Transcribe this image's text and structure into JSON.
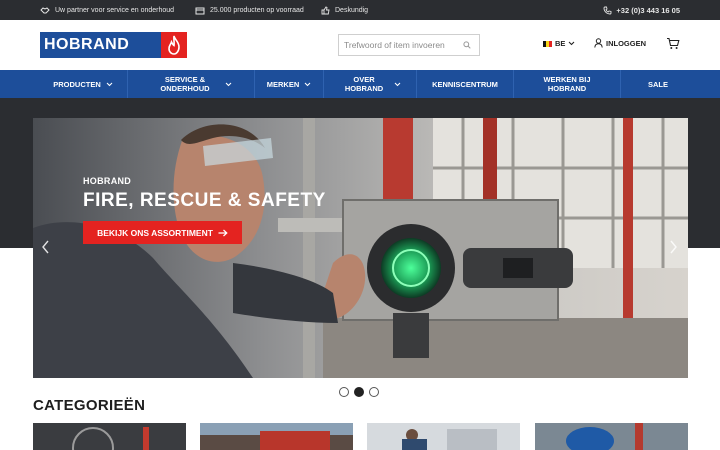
{
  "topbar": {
    "usp_service": "Uw partner voor service en onderhoud",
    "usp_products": "25.000 producten op voorraad",
    "usp_expert": "Deskundig",
    "phone": "+32 (0)3 443 16 05"
  },
  "header": {
    "logo_text": "HOBRAND",
    "search_placeholder": "Trefwoord of item invoeren",
    "language": "BE",
    "login": "INLOGGEN"
  },
  "nav": {
    "items": [
      {
        "label": "PRODUCTEN",
        "dropdown": true
      },
      {
        "label": "SERVICE & ONDERHOUD",
        "dropdown": true
      },
      {
        "label": "MERKEN",
        "dropdown": true
      },
      {
        "label": "OVER HOBRAND",
        "dropdown": true
      },
      {
        "label": "KENNISCENTRUM",
        "dropdown": false
      },
      {
        "label": "WERKEN BIJ HOBRAND",
        "dropdown": false
      },
      {
        "label": "SALE",
        "dropdown": false
      }
    ]
  },
  "hero": {
    "eyebrow": "HOBRAND",
    "title": "FIRE, RESCUE & SAFETY",
    "cta": "BEKIJK ONS ASSORTIMENT",
    "slides": 3,
    "active_slide": 2
  },
  "categories": {
    "title": "CATEGORIEËN"
  },
  "colors": {
    "brand_blue": "#1d4e9a",
    "brand_red": "#e42320",
    "topbar": "#2b2d31"
  }
}
